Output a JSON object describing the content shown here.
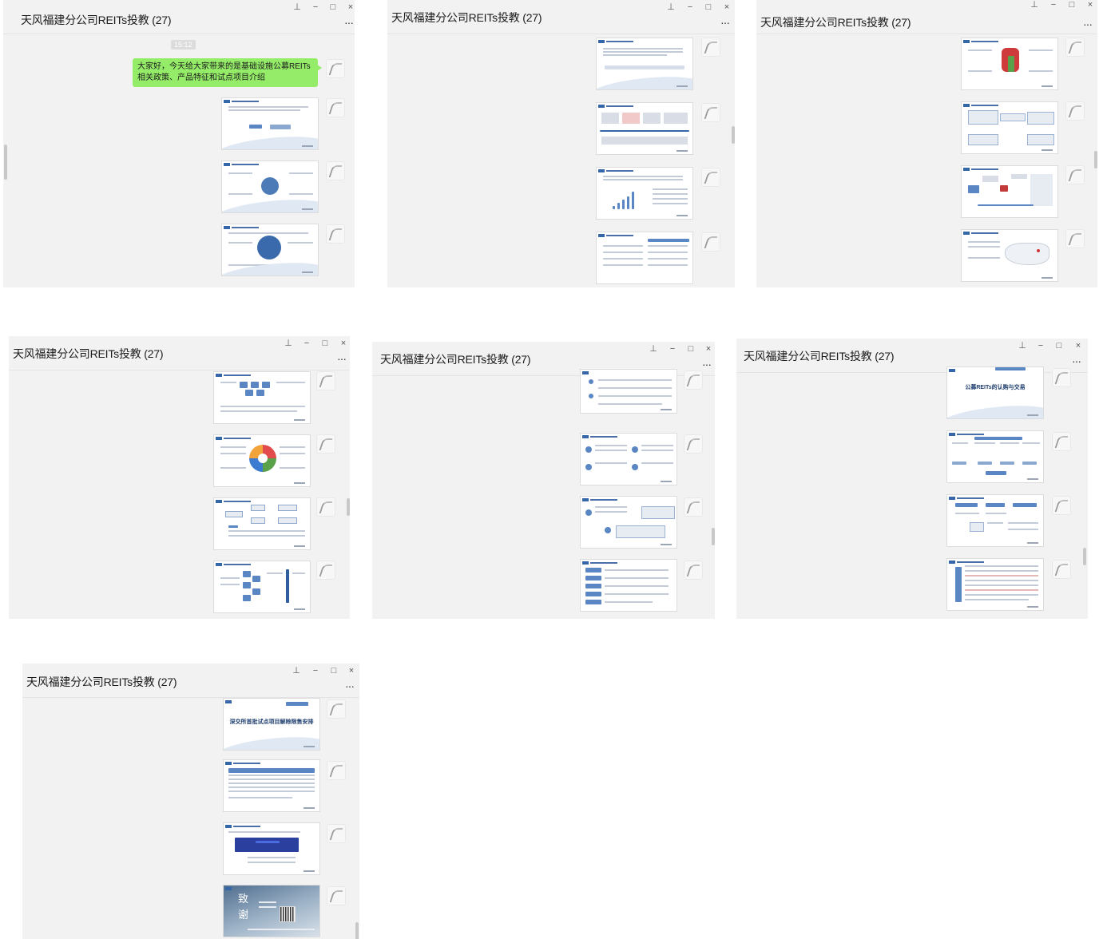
{
  "group_title": "天风福建分公司REITs投教 (27)",
  "window_controls": {
    "pin": "⊥",
    "minimize": "−",
    "maximize": "□",
    "close": "×",
    "more": "···"
  },
  "chat": {
    "timestamp": "15:12",
    "intro_message": "大家好，今天给大家带来的是基础设施公募REITs相关政策、产品特征和试点项目介绍"
  },
  "slides": {
    "listing_cover_title": "公募REITs的认购与交易",
    "lockup_cover_title": "深交所首批试点项目解除限售安排",
    "thanks_text": "致谢"
  }
}
